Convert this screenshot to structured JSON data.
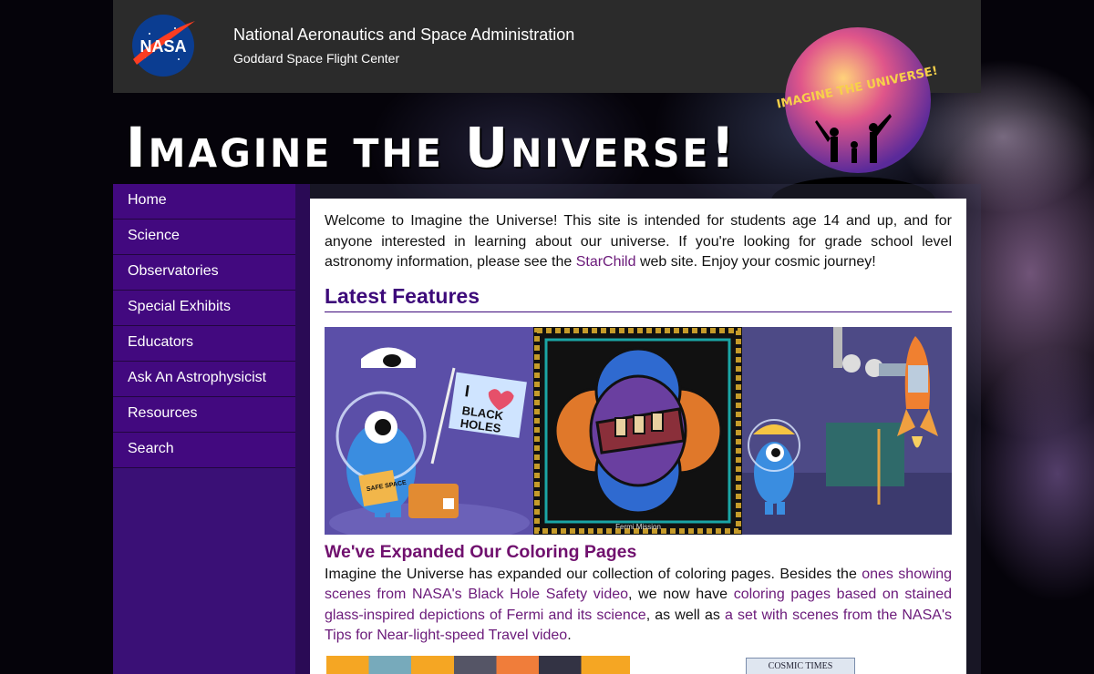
{
  "header": {
    "agency": "National Aeronautics and Space Administration",
    "center": "Goddard Space Flight Center",
    "logo_text": "NASA"
  },
  "banner": {
    "site_title": "Imagine the Universe!",
    "badge_text": "IMAGINE THE UNIVERSE!"
  },
  "sidebar": {
    "items": [
      {
        "label": "Home"
      },
      {
        "label": "Science"
      },
      {
        "label": "Observatories"
      },
      {
        "label": "Special Exhibits"
      },
      {
        "label": "Educators"
      },
      {
        "label": "Ask An Astrophysicist"
      },
      {
        "label": "Resources"
      },
      {
        "label": "Search"
      }
    ]
  },
  "main": {
    "intro_before": "Welcome to Imagine the Universe! This site is intended for students age 14 and up, and for anyone interested in learning about our universe. If you're looking for grade school level astronomy information, please see the ",
    "intro_link": "StarChild",
    "intro_after": " web site. Enjoy your cosmic journey!",
    "features_heading": "Latest Features",
    "feature_image": {
      "flag_text_1": "I",
      "flag_text_2": "BLACK",
      "flag_text_3": "HOLES",
      "book_text": "SAFE SPACE",
      "caption": "Fermi Mission"
    },
    "article": {
      "title": "We've Expanded Our Coloring Pages",
      "text_1": "Imagine the Universe has expanded our collection of coloring pages. Besides the ",
      "link_1": "ones showing scenes from NASA's Black Hole Safety video",
      "text_2": ", we now have ",
      "link_2": "coloring pages based on stained glass-inspired depictions of Fermi and its science",
      "text_3": ", as well as ",
      "link_3": "a set with scenes from the NASA's Tips for Near-light-speed Travel video",
      "text_4": "."
    },
    "thumb_label": "COSMIC TIMES"
  },
  "colors": {
    "nav_bg": "#42097f",
    "heading": "#3d0a7a",
    "link": "#6b1a7a",
    "topbar": "#2b2b2b"
  }
}
